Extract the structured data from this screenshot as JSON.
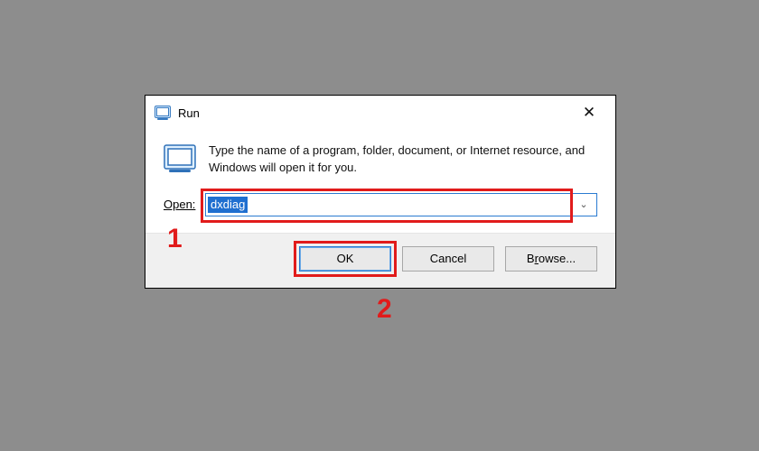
{
  "window": {
    "title": "Run",
    "close_glyph": "✕"
  },
  "body": {
    "description": "Type the name of a program, folder, document, or Internet resource, and Windows will open it for you."
  },
  "open": {
    "label": "Open:",
    "value": "dxdiag",
    "chevron": "⌄"
  },
  "buttons": {
    "ok": "OK",
    "cancel": "Cancel",
    "browse_pre": "B",
    "browse_u": "r",
    "browse_post": "owse..."
  },
  "annotations": {
    "one": "1",
    "two": "2"
  }
}
